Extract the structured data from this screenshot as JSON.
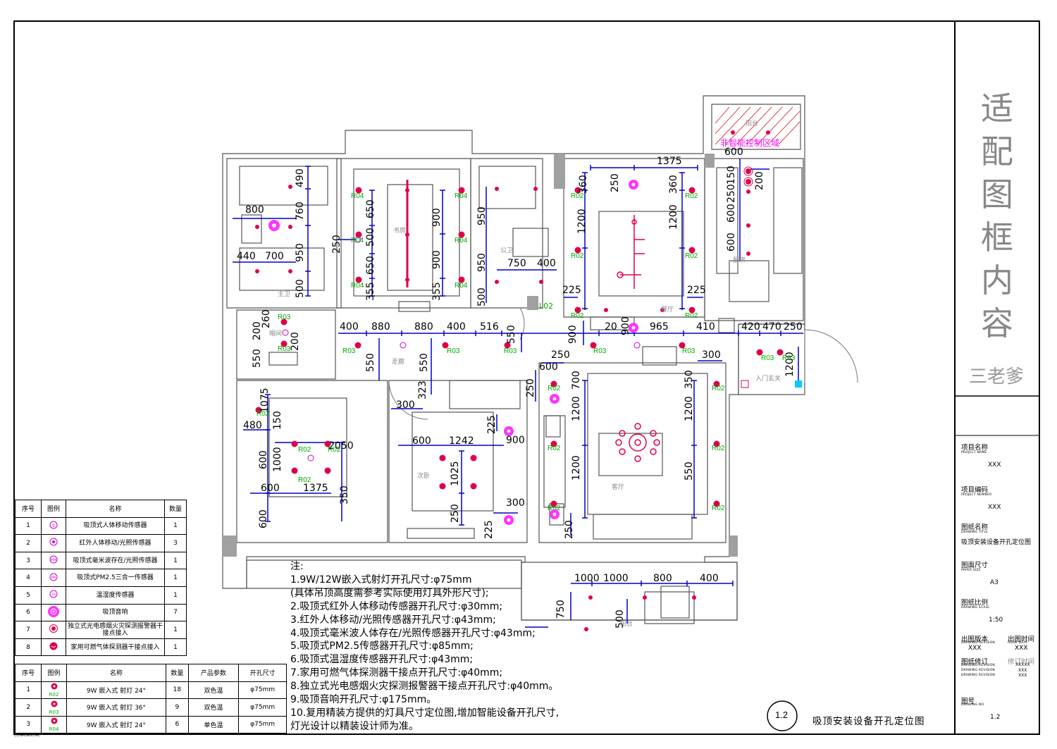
{
  "title_block": {
    "vertical_title_chars": [
      "适",
      "配",
      "图",
      "框",
      "内",
      "容"
    ],
    "brand": "三老爹",
    "fields": [
      {
        "label": "项目名称",
        "sub": "PROJECT NAME",
        "value": "XXX"
      },
      {
        "label": "项目编码",
        "sub": "PROJECT NUMBER",
        "value": "XXX"
      },
      {
        "label": "图纸名称",
        "sub": "DRAWING TITLE",
        "value": "吸顶安装设备开孔定位图"
      },
      {
        "label": "图面尺寸",
        "sub": "PAPER SIZE",
        "value": "A3"
      },
      {
        "label": "图纸比例",
        "sub": "DRAWING SCALE",
        "value": "1:50"
      }
    ],
    "issue": {
      "label1": "出图版本",
      "sub1": "DRAWING REVISION",
      "value1": "XXX",
      "label2": "出图时间",
      "sub2": "ISSUE DATE",
      "value2": "XXX"
    },
    "revision": {
      "label": "图纸修订",
      "label2": "修订时间",
      "sub": "DRAWING REVISION",
      "values": [
        "XXXXX",
        "XXX",
        "XXX"
      ]
    },
    "drawing_no": {
      "label": "图号",
      "sub": "DRAWING NO.",
      "value": "1.2"
    }
  },
  "drawing_title": {
    "number": "1.2",
    "text": "吸顶安装设备开孔定位图"
  },
  "confidential": "CONFIDENTIAL",
  "non_smart_zone": "非智能控制区域",
  "rooms": {
    "master_bath": "主卫",
    "study": "书房",
    "public_bath": "公卫",
    "dining": "餐厅",
    "kitchen": "厨房",
    "corridor": "走廊",
    "cloakroom": "帽间",
    "entrance": "入门玄关",
    "second_bedroom": "次卧",
    "living": "客厅",
    "balcony": "阳台",
    "balcony2": "阳台"
  },
  "dimensions": [
    "490",
    "760",
    "800",
    "950",
    "440",
    "700",
    "500",
    "260",
    "200",
    "200",
    "550",
    "250",
    "650",
    "500",
    "650",
    "355",
    "900",
    "900",
    "355",
    "950",
    "950",
    "500",
    "750",
    "400",
    "L02",
    "1375",
    "250",
    "360",
    "360",
    "1200",
    "1200",
    "225",
    "225",
    "600",
    "150",
    "250",
    "200",
    "600",
    "600",
    "400",
    "880",
    "880",
    "400",
    "516",
    "550",
    "550",
    "550",
    "900",
    "20",
    "900",
    "965",
    "410",
    "420",
    "470",
    "250",
    "250",
    "300",
    "600",
    "250",
    "700",
    "1200",
    "1200",
    "1200",
    "1200",
    "550",
    "250",
    "350",
    "1075",
    "150",
    "480",
    "300",
    "323",
    "225",
    "900",
    "600",
    "1242",
    "2050",
    "600",
    "1000",
    "600",
    "1375",
    "350",
    "600",
    "1025",
    "250",
    "225",
    "300",
    "1000",
    "1000",
    "800",
    "400",
    "750",
    "500"
  ],
  "tags": {
    "r02": "R02",
    "r03": "R03",
    "r04": "R04"
  },
  "notes": [
    "注:",
    "1.9W/12W嵌入式射灯开孔尺寸:φ75mm",
    "(具体吊顶高度需参考实际使用灯具外形尺寸);",
    "2.吸顶式红外人体移动传感器开孔尺寸:φ30mm;",
    "3.红外人体移动/光照传感器开孔尺寸:φ43mm;",
    "4.吸顶式毫米波人体存在/光照传感器开孔尺寸:φ43mm;",
    "5.吸顶式PM2.5传感器开孔尺寸:φ85mm;",
    "6.吸顶式温湿度传感器开孔尺寸:φ43mm;",
    "7.家用可燃气体探测器干接点开孔尺寸:φ40mm;",
    "8.独立式光电感烟火灾探测报警器干接点开孔尺寸:φ40mm。",
    "9.吸顶音响开孔尺寸:φ175mm。",
    "10.复用精装方提供的灯具尺寸定位图,增加智能设备开孔尺寸,",
    "灯光设计以精装设计师为准。"
  ],
  "legend_sensors": {
    "headers": [
      "序号",
      "图例",
      "名称",
      "数量"
    ],
    "rows": [
      {
        "no": "1",
        "symbol": "S",
        "name": "吸顶式人体移动传感器",
        "qty": "1",
        "kind": "s"
      },
      {
        "no": "2",
        "symbol": "",
        "name": "红外人体移动/光照传感器",
        "qty": "3",
        "kind": "ir"
      },
      {
        "no": "3",
        "symbol": "MW",
        "name": "吸顶式毫米波存在/光照传感器",
        "qty": "1",
        "kind": "mw"
      },
      {
        "no": "4",
        "symbol": "PM",
        "name": "吸顶式PM2.5三合一传感器",
        "qty": "1",
        "kind": "pm"
      },
      {
        "no": "5",
        "symbol": "TH",
        "name": "温湿度传感器",
        "qty": "1",
        "kind": "th"
      },
      {
        "no": "6",
        "symbol": "",
        "name": "吸顶音响",
        "qty": "7",
        "kind": "spk"
      },
      {
        "no": "7",
        "symbol": "",
        "name": "独立式光电感烟火灾探测报警器干接点接入",
        "qty": "1",
        "kind": "smoke"
      },
      {
        "no": "8",
        "symbol": "",
        "name": "家用可燃气体探测器干接点接入",
        "qty": "1",
        "kind": "gas"
      }
    ]
  },
  "legend_lights": {
    "headers": [
      "序号",
      "图例",
      "名称",
      "数量",
      "产品参数",
      "开孔尺寸"
    ],
    "rows": [
      {
        "no": "1",
        "tag": "R02",
        "name": "9W 嵌入式 射灯 24°",
        "qty": "18",
        "param": "双色温",
        "hole": "φ75mm"
      },
      {
        "no": "2",
        "tag": "R03",
        "name": "9W 嵌入式 射灯 36°",
        "qty": "9",
        "param": "双色温",
        "hole": "φ75mm"
      },
      {
        "no": "3",
        "tag": "R04",
        "name": "9W 嵌入式 射灯 24°",
        "qty": "6",
        "param": "单色温",
        "hole": "φ75mm"
      }
    ]
  },
  "colors": {
    "light": "#e0004a",
    "sensor": "#cc00cc",
    "dim": "#0000cc",
    "tag": "#00aa00",
    "magenta": "#ff00ff"
  }
}
